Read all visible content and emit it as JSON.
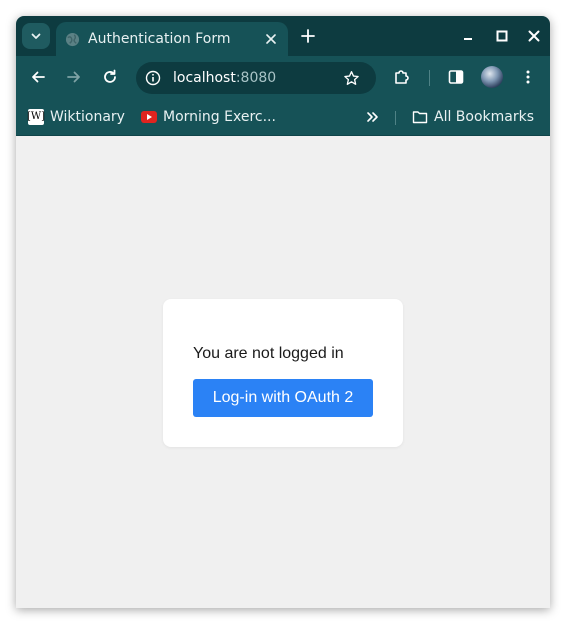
{
  "browser": {
    "tab_title": "Authentication Form",
    "url_host": "localhost",
    "url_port": ":8080"
  },
  "bookmarks": {
    "items": [
      {
        "label": "Wiktionary",
        "icon": "wiktionary-icon"
      },
      {
        "label": "Morning Exerc...",
        "icon": "youtube-icon"
      }
    ],
    "all_label": "All Bookmarks"
  },
  "page": {
    "status_text": "You are not logged in",
    "login_button_label": "Log-in with OAuth 2"
  },
  "colors": {
    "frame_dark": "#0d3b40",
    "frame": "#165257",
    "button_accent": "#2b82f5",
    "page_bg": "#f0f0f0"
  }
}
